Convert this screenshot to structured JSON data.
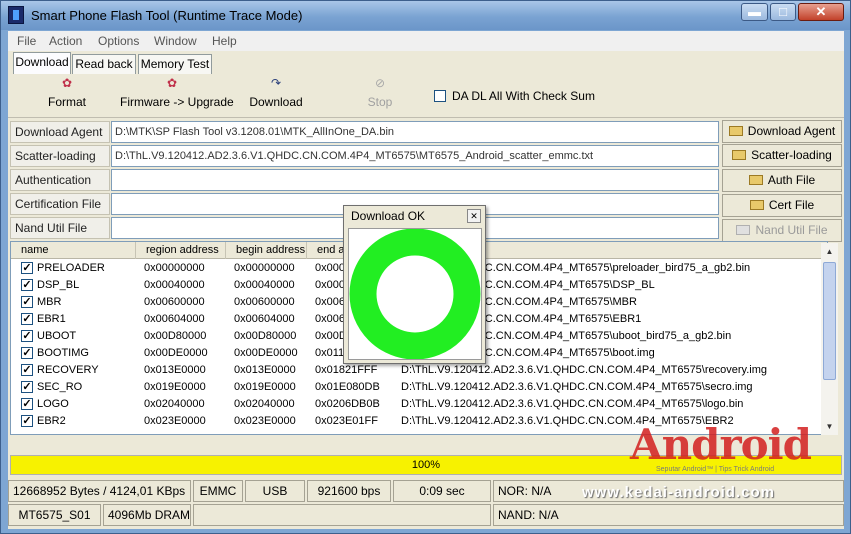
{
  "window": {
    "title": "Smart Phone Flash Tool (Runtime Trace Mode)",
    "controls": {
      "minimize": "▬",
      "maximize": "□",
      "close": "✕"
    }
  },
  "menu": [
    "File",
    "Action",
    "Options",
    "Window",
    "Help"
  ],
  "tabs": [
    "Download",
    "Read back",
    "Memory Test"
  ],
  "toolbar": {
    "format": "Format",
    "firmware_upgrade": "Firmware -> Upgrade",
    "download": "Download",
    "stop": "Stop",
    "checksum_label": "DA DL All With Check Sum",
    "checksum_checked": false
  },
  "fields": {
    "download_agent": {
      "label": "Download Agent",
      "value": "D:\\MTK\\SP Flash Tool v3.1208.01\\MTK_AllInOne_DA.bin",
      "button": "Download Agent"
    },
    "scatter": {
      "label": "Scatter-loading File",
      "value": "D:\\ThL.V9.120412.AD2.3.6.V1.QHDC.CN.COM.4P4_MT6575\\MT6575_Android_scatter_emmc.txt",
      "button": "Scatter-loading"
    },
    "auth": {
      "label": "Authentication File",
      "value": "",
      "button": "Auth File"
    },
    "cert": {
      "label": "Certification File",
      "value": "",
      "button": "Cert File"
    },
    "nand": {
      "label": "Nand Util File",
      "value": "",
      "button": "Nand Util File"
    }
  },
  "table": {
    "columns": [
      "name",
      "region address",
      "begin address",
      "end a..."
    ],
    "rows": [
      {
        "name": "PRELOADER",
        "region": "0x00000000",
        "begin": "0x00000000",
        "end": "0x0001",
        "location": "AD2.3.6.V1.QHDC.CN.COM.4P4_MT6575\\preloader_bird75_a_gb2.bin"
      },
      {
        "name": "DSP_BL",
        "region": "0x00040000",
        "begin": "0x00040000",
        "end": "0x0004",
        "location": "AD2.3.6.V1.QHDC.CN.COM.4P4_MT6575\\DSP_BL"
      },
      {
        "name": "MBR",
        "region": "0x00600000",
        "begin": "0x00600000",
        "end": "0x0060",
        "location": "AD2.3.6.V1.QHDC.CN.COM.4P4_MT6575\\MBR"
      },
      {
        "name": "EBR1",
        "region": "0x00604000",
        "begin": "0x00604000",
        "end": "0x0060",
        "location": "AD2.3.6.V1.QHDC.CN.COM.4P4_MT6575\\EBR1"
      },
      {
        "name": "UBOOT",
        "region": "0x00D80000",
        "begin": "0x00D80000",
        "end": "0x00D",
        "location": "AD2.3.6.V1.QHDC.CN.COM.4P4_MT6575\\uboot_bird75_a_gb2.bin"
      },
      {
        "name": "BOOTIMG",
        "region": "0x00DE0000",
        "begin": "0x00DE0000",
        "end": "0x0113",
        "location": "AD2.3.6.V1.QHDC.CN.COM.4P4_MT6575\\boot.img"
      },
      {
        "name": "RECOVERY",
        "region": "0x013E0000",
        "begin": "0x013E0000",
        "end": "0x01821FFF",
        "location": "D:\\ThL.V9.120412.AD2.3.6.V1.QHDC.CN.COM.4P4_MT6575\\recovery.img"
      },
      {
        "name": "SEC_RO",
        "region": "0x019E0000",
        "begin": "0x019E0000",
        "end": "0x01E080DB",
        "location": "D:\\ThL.V9.120412.AD2.3.6.V1.QHDC.CN.COM.4P4_MT6575\\secro.img"
      },
      {
        "name": "LOGO",
        "region": "0x02040000",
        "begin": "0x02040000",
        "end": "0x0206DB0B",
        "location": "D:\\ThL.V9.120412.AD2.3.6.V1.QHDC.CN.COM.4P4_MT6575\\logo.bin"
      },
      {
        "name": "EBR2",
        "region": "0x023E0000",
        "begin": "0x023E0000",
        "end": "0x023E01FF",
        "location": "D:\\ThL.V9.120412.AD2.3.6.V1.QHDC.CN.COM.4P4_MT6575\\EBR2"
      }
    ]
  },
  "progress": {
    "text": "100%",
    "fraction": 1.0,
    "color": "#f7f200"
  },
  "status": {
    "bytes": "12668952 Bytes / 4124,01 KBps",
    "storage": "EMMC",
    "port": "USB",
    "baud": "921600 bps",
    "time": "0:09 sec",
    "nor": "NOR: N/A",
    "chip": "MT6575_S01",
    "dram": "4096Mb DRAM",
    "nand": "NAND: N/A"
  },
  "dialog": {
    "title": "Download OK",
    "close": "✕",
    "ring_color": "#22ee22"
  },
  "watermark": {
    "site": "www.kedai-android.com",
    "tagline": "Seputar Android™ | Tips Trick Android",
    "logo": "Android"
  },
  "colors": {
    "window_frame": "#7ea6d3",
    "panel": "#ece9d8",
    "check": "#1c5180"
  }
}
